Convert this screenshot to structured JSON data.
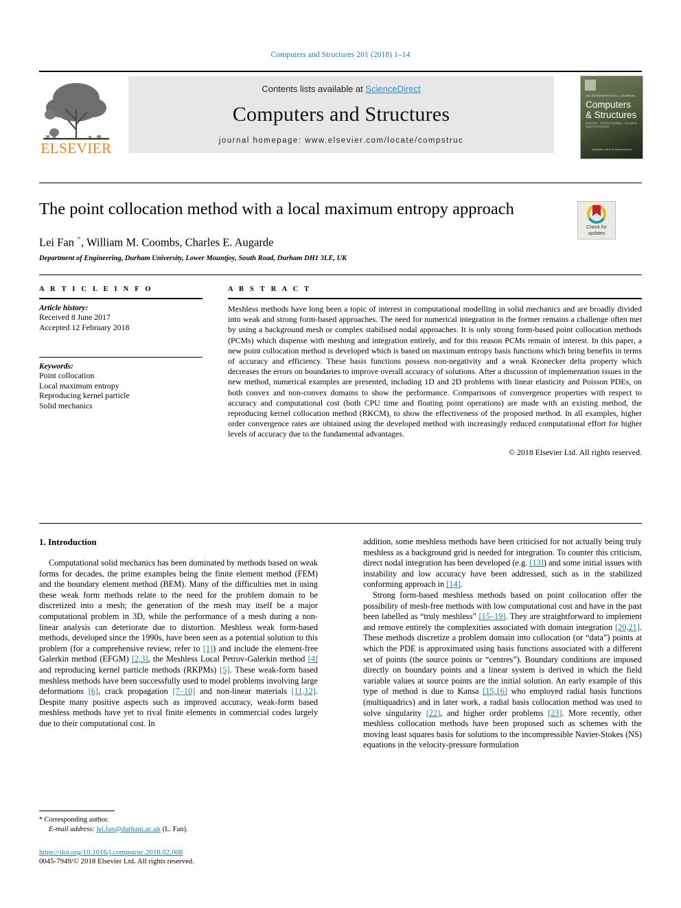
{
  "running_head": "Computers and Structures 201 (2018) 1–14",
  "masthead": {
    "contents_prefix": "Contents lists available at ",
    "sciencedirect": "ScienceDirect",
    "journal_title": "Computers and Structures",
    "homepage": "journal homepage: www.elsevier.com/locate/compstruc",
    "publisher_logo": "ELSEVIER",
    "cover": {
      "issn_line": "AN INTERNATIONAL JOURNAL",
      "title_line1": "Computers",
      "title_line2": "& Structures",
      "subtitle": "SOLIDS · STRUCTURES · FLUIDS · MULTIPHYSICS",
      "footer": "Available online at\nScienceDirect"
    }
  },
  "article": {
    "title": "The point collocation method with a local maximum entropy approach",
    "authors": "Lei Fan ",
    "authors_rest": ", William M. Coombs, Charles E. Augarde",
    "corresponding_marker": "*",
    "affiliation": "Department of Engineering, Durham University, Lower Mountjoy, South Road, Durham DH1 3LE, UK",
    "crossmark": {
      "line1": "Check for",
      "line2": "updates"
    }
  },
  "article_info": {
    "heading": "A R T I C L E   I N F O",
    "history_label": "Article history:",
    "history": [
      "Received 8 June 2017",
      "Accepted 12 February 2018"
    ],
    "keywords_label": "Keywords:",
    "keywords": [
      "Point collocation",
      "Local maximum entropy",
      "Reproducing kernel particle",
      "Solid mechanics"
    ]
  },
  "abstract": {
    "heading": "A B S T R A C T",
    "text": "Meshless methods have long been a topic of interest in computational modelling in solid mechanics and are broadly divided into weak and strong form-based approaches. The need for numerical integration in the former remains a challenge often met by using a background mesh or complex stabilised nodal approaches. It is only strong form-based point collocation methods (PCMs) which dispense with meshing and integration entirely, and for this reason PCMs remain of interest. In this paper, a new point collocation method is developed which is based on maximum entropy basis functions which bring benefits in terms of accuracy and efficiency. These basis functions possess non-negativity and a weak Kronecker delta property which decreases the errors on boundaries to improve overall accuracy of solutions. After a discussion of implementation issues in the new method, numerical examples are presented, including 1D and 2D problems with linear elasticity and Poisson PDEs, on both convex and non-convex domains to show the performance. Comparisons of convergence properties with respect to accuracy and computational cost (both CPU time and floating point operations) are made with an existing method, the reproducing kernel collocation method (RKCM), to show the effectiveness of the proposed method. In all examples, higher order convergence rates are obtained using the developed method with increasingly reduced computational effort for higher levels of accuracy due to the fundamental advantages.",
    "copyright": "© 2018 Elsevier Ltd. All rights reserved."
  },
  "body": {
    "section_heading": "1. Introduction",
    "left_para_1_a": "Computational solid mechanics has been dominated by methods based on weak forms for decades, the prime examples being the finite element method (FEM) and the boundary element method (BEM). Many of the difficulties met in using these weak form methods relate to the need for the problem domain to be discretized into a mesh; the generation of the mesh may itself be a major computational problem in 3D, while the performance of a mesh during a non-linear analysis can deteriorate due to distortion. Meshless weak form-based methods, developed since the 1990s, have been seen as a potential solution to this problem (for a comprehensive review, refer to ",
    "cite_1": "[1]",
    "left_para_1_b": ") and include the element-free Galerkin method (EFGM) ",
    "cite_2_3": "[2,3]",
    "left_para_1_c": ", the Meshless Local Petrov-Galerkin method ",
    "cite_4": "[4]",
    "left_para_1_d": " and reproducing kernel particle methods (RKPMs) ",
    "cite_5": "[5]",
    "left_para_1_e": ". These weak-form based meshless methods have been successfully used to model problems involving large deformations ",
    "cite_6": "[6]",
    "left_para_1_f": ", crack propagation ",
    "cite_7_10": "[7–10]",
    "left_para_1_g": " and non-linear materials ",
    "cite_11_12": "[11,12]",
    "left_para_1_h": ". Despite many positive aspects such as improved accuracy, weak-form based meshless methods have yet to rival finite elements in commercial codes largely due to their computational cost. In",
    "right_para_1_a": "addition, some meshless methods have been criticised for not actually being truly meshless as a background grid is needed for integration. To counter this criticism, direct nodal integration has been developed (e.g. ",
    "cite_13": "[13]",
    "right_para_1_b": ") and some initial issues with instability and low accuracy have been addressed, such as in the stabilized conforming approach in ",
    "cite_14": "[14]",
    "right_para_1_c": ".",
    "right_para_2_a": "Strong form-based meshless methods based on point collocation offer the possibility of mesh-free methods with low computational cost and have in the past been labelled as “truly meshless” ",
    "cite_15_19": "[15–19]",
    "right_para_2_b": ". They are straightforward to implement and remove entirely the complexities associated with domain integration ",
    "cite_20_21": "[20,21]",
    "right_para_2_c": ". These methods discretize a problem domain into collocation (or “data”) points at which the PDE is approximated using basis functions associated with a different set of points (the source points or “centres”). Boundary conditions are imposed directly on boundary points and a linear system is derived in which the field variable values at source points are the initial solution. An early example of this type of method is due to Kansa ",
    "cite_15_16": "[15,16]",
    "right_para_2_d": " who employed radial basis functions (multiquadrics) and in later work, a radial basis collocation method was used to solve singularity ",
    "cite_22": "[22]",
    "right_para_2_e": ", and higher order problems ",
    "cite_23": "[23]",
    "right_para_2_f": ". More recently, other meshless collocation methods have been proposed such as schemes with the moving least squares basis for solutions to the incompressible Navier-Stokes (NS) equations in the velocity-pressure formulation"
  },
  "footnote": {
    "star": "*",
    "corresponding": " Corresponding author.",
    "email_label": "E-mail address:",
    "email": "lei.fan@durham.ac.uk",
    "email_suffix": " (L. Fan)."
  },
  "footer": {
    "doi": "https://doi.org/10.1016/j.compstruc.2018.02.008",
    "issn": "0045-7949/© 2018 Elsevier Ltd. All rights reserved."
  },
  "colors": {
    "link": "#1c7ea3",
    "sciencedirect": "#2c8fc9",
    "running_head": "#1f7ba8",
    "elsevier_orange": "#f07f13"
  }
}
